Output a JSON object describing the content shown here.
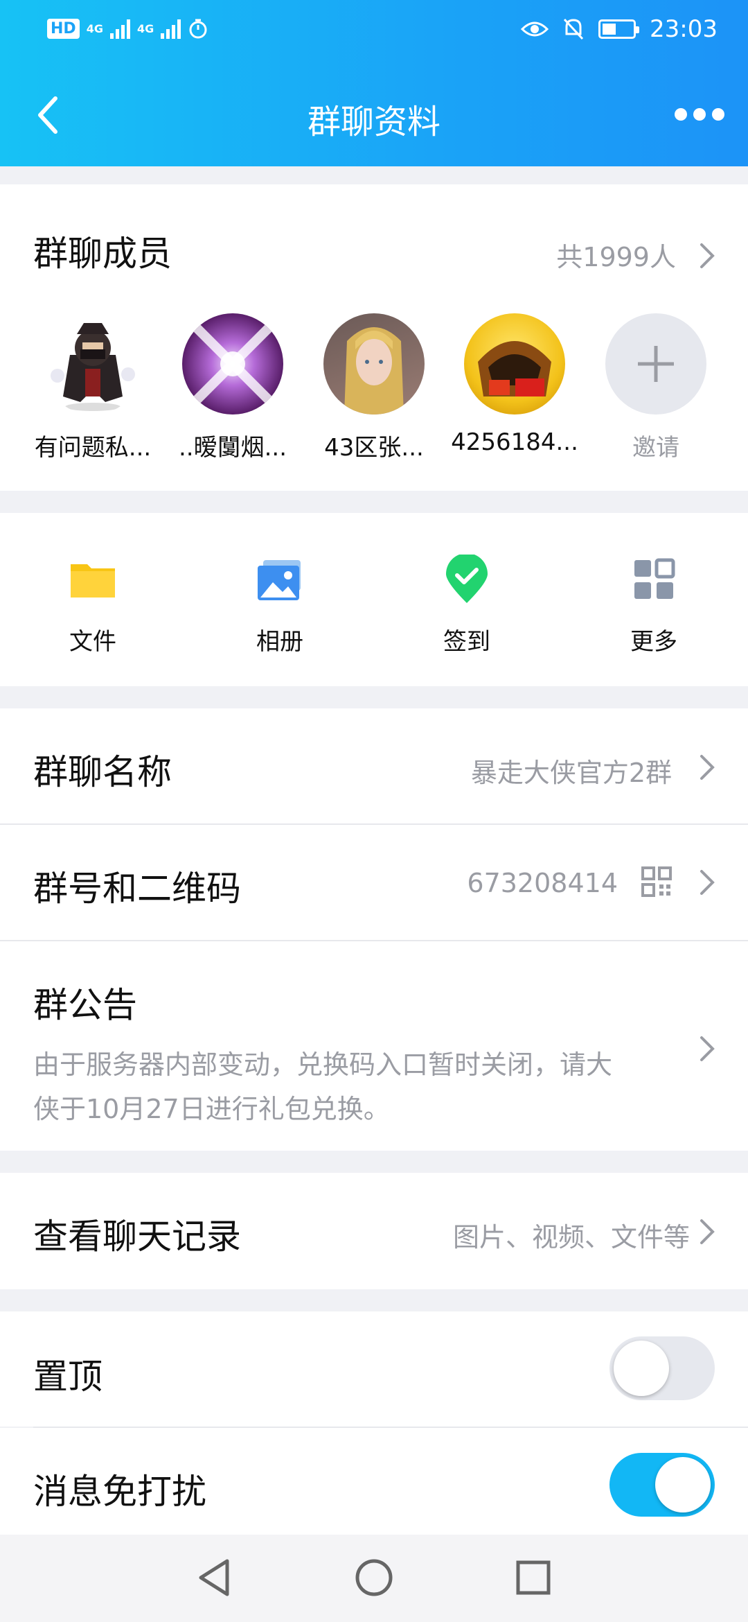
{
  "status_bar": {
    "hd_badge": "HD",
    "sim1_net": "4G",
    "sim2_net": "4G",
    "time": "23:03"
  },
  "header": {
    "title": "群聊资料"
  },
  "members": {
    "title": "群聊成员",
    "count": "共1999人",
    "avatars": [
      {
        "name": "有问题私..."
      },
      {
        "name": "..暧闅烟..."
      },
      {
        "name": "43区张..."
      },
      {
        "name": "4256184..."
      }
    ],
    "invite_label": "邀请"
  },
  "quick_actions": [
    {
      "label": "文件",
      "icon": "folder-icon"
    },
    {
      "label": "相册",
      "icon": "album-icon"
    },
    {
      "label": "签到",
      "icon": "checkin-icon"
    },
    {
      "label": "更多",
      "icon": "grid-more-icon"
    }
  ],
  "group_name": {
    "label": "群聊名称",
    "value": "暴走大侠官方2群"
  },
  "group_number": {
    "label": "群号和二维码",
    "value": "673208414"
  },
  "announcement": {
    "label": "群公告",
    "text_line1": "由于服务器内部变动，兑换码入口暂时关闭，请大",
    "text_line2": "侠于10月27日进行礼包兑换。"
  },
  "chat_history": {
    "label": "查看聊天记录",
    "value": "图片、视频、文件等"
  },
  "pin_top": {
    "label": "置顶",
    "enabled": false
  },
  "do_not_disturb": {
    "label": "消息免打扰",
    "enabled": true
  },
  "colors": {
    "header_gradient_start": "#17c2f5",
    "header_gradient_end": "#1c93f7",
    "toggle_on": "#12b7f5",
    "secondary_text": "#9a9ca3"
  }
}
